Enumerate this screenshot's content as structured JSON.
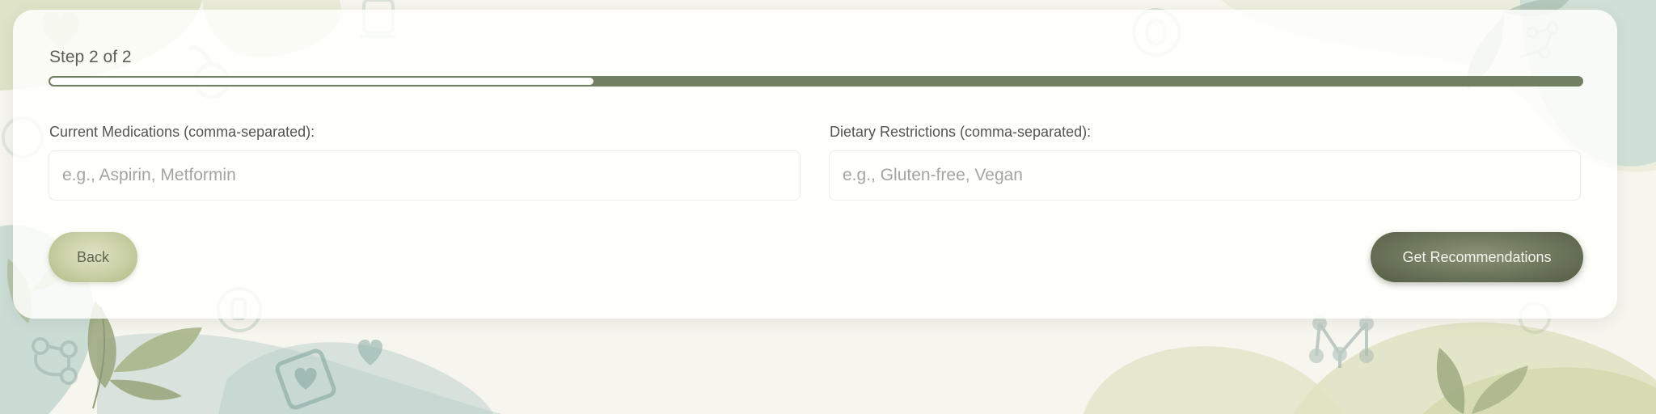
{
  "progress": {
    "step_text": "Step 2 of 2",
    "fraction": 0.355
  },
  "form": {
    "medications": {
      "label": "Current Medications (comma-separated):",
      "value": "",
      "placeholder": "e.g., Aspirin, Metformin"
    },
    "diet": {
      "label": "Dietary Restrictions (comma-separated):",
      "value": "",
      "placeholder": "e.g., Gluten-free, Vegan"
    }
  },
  "buttons": {
    "back_label": "Back",
    "submit_label": "Get Recommendations"
  },
  "colors": {
    "accent_dark": "#737f63",
    "accent_light": "#c9cfa4",
    "text": "#55554f",
    "placeholder": "#a4a4a0"
  },
  "icons": {
    "background": [
      "heart-icon",
      "leaf-icon",
      "molecule-icon",
      "pill-bottle-icon",
      "apple-icon"
    ]
  }
}
